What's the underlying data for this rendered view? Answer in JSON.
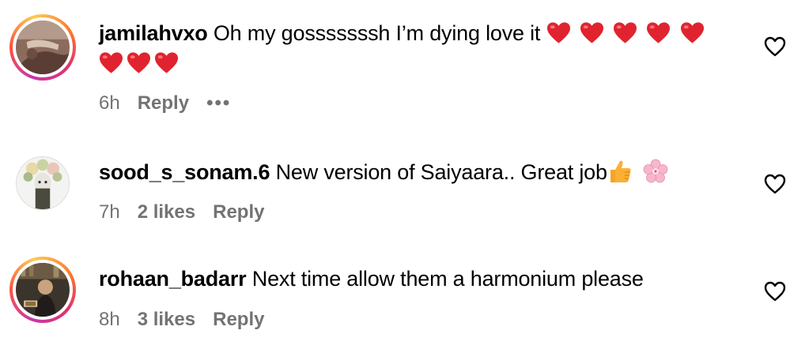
{
  "comments": [
    {
      "username": "jamilahvxo",
      "text": "Oh my gosssssssh I’m dying love it",
      "hearts_line1": 5,
      "hearts_line2": 3,
      "time": "6h",
      "likes": "",
      "reply_label": "Reply",
      "more_label": "•••",
      "has_story": true
    },
    {
      "username": "sood_s_sonam.6",
      "text": "New version of Saiyaara.. Great job",
      "emojis": [
        "thumbs-up",
        "cherry-blossom"
      ],
      "time": "7h",
      "likes": "2 likes",
      "reply_label": "Reply",
      "has_story": false
    },
    {
      "username": "rohaan_badarr",
      "text": "Next time allow them a harmonium please",
      "time": "8h",
      "likes": "3 likes",
      "reply_label": "Reply",
      "has_story": true
    }
  ],
  "icons": {
    "heart_emoji": "red-heart-emoji",
    "like_button": "heart-outline-icon",
    "thumbs": "thumbs-up-emoji",
    "flower": "cherry-blossom-emoji"
  },
  "colors": {
    "text": "#000000",
    "meta": "#737373",
    "heart_red": "#e0242f",
    "thumb_yellow": "#fbb034",
    "blossom_pink": "#f7b6cc"
  }
}
